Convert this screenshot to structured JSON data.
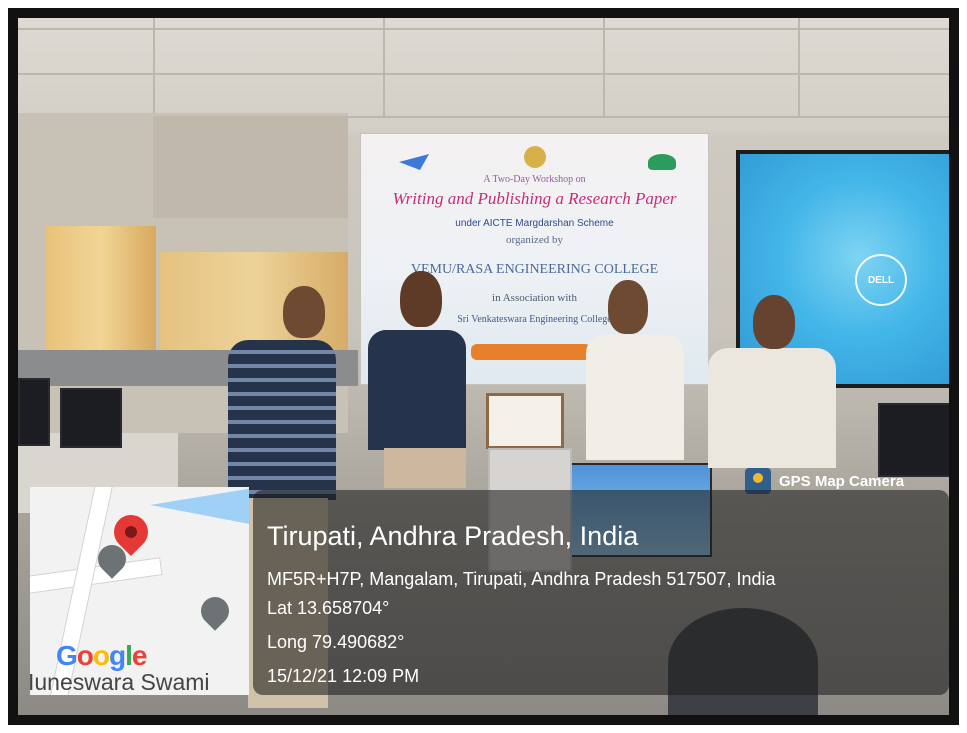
{
  "banner": {
    "line1": "A Two-Day Workshop on",
    "title": "Writing and Publishing a Research Paper",
    "scheme": "under AICTE Margdarshan Scheme",
    "organized": "organized by",
    "college": "VEMU/RASA ENGINEERING COLLEGE",
    "association": "in Association with",
    "partner": "Sri Venkateswara Engineering College"
  },
  "screen": {
    "brand": "DELL"
  },
  "gps_overlay": {
    "app_name": "GPS Map Camera",
    "location_title": "Tirupati, Andhra Pradesh, India",
    "address": "MF5R+H7P, Mangalam, Tirupati, Andhra Pradesh 517507, India",
    "latitude": "Lat 13.658704°",
    "longitude": "Long 79.490682°",
    "datetime": "15/12/21 12:09 PM",
    "map_brand": "Google",
    "map_label": "Iuneswara Swami"
  },
  "colors": {
    "overlay_bg": "#1e1e1e",
    "pin_red": "#e53935",
    "google_blue": "#4285F4",
    "google_red": "#EA4335",
    "google_yellow": "#FBBC05",
    "google_green": "#34A853"
  }
}
